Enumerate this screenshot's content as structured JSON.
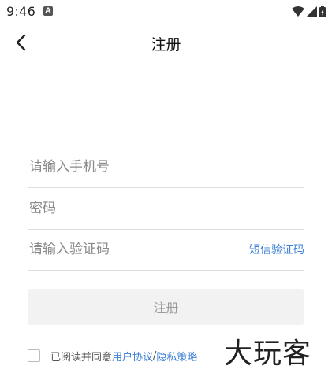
{
  "status_bar": {
    "time": "9:46",
    "notification_icon": "a-letter-icon",
    "icons": [
      "wifi-icon",
      "signal-icon",
      "battery-icon"
    ]
  },
  "nav": {
    "title": "注册",
    "back_icon": "chevron-left-icon"
  },
  "form": {
    "phone": {
      "placeholder": "请输入手机号",
      "value": ""
    },
    "password": {
      "placeholder": "密码",
      "value": ""
    },
    "code": {
      "placeholder": "请输入验证码",
      "value": ""
    },
    "sms_link": "短信验证码",
    "register_button": "注册"
  },
  "agreement": {
    "checked": false,
    "text": "已阅读并同意",
    "user_agreement": "用户协议",
    "separator": "/",
    "privacy_policy": "隐私策略"
  },
  "watermark": "大玩客",
  "colors": {
    "link": "#3b7fd6",
    "button_bg": "#f2f2f2",
    "button_text": "#9a9a9a",
    "divider": "#dedede"
  }
}
